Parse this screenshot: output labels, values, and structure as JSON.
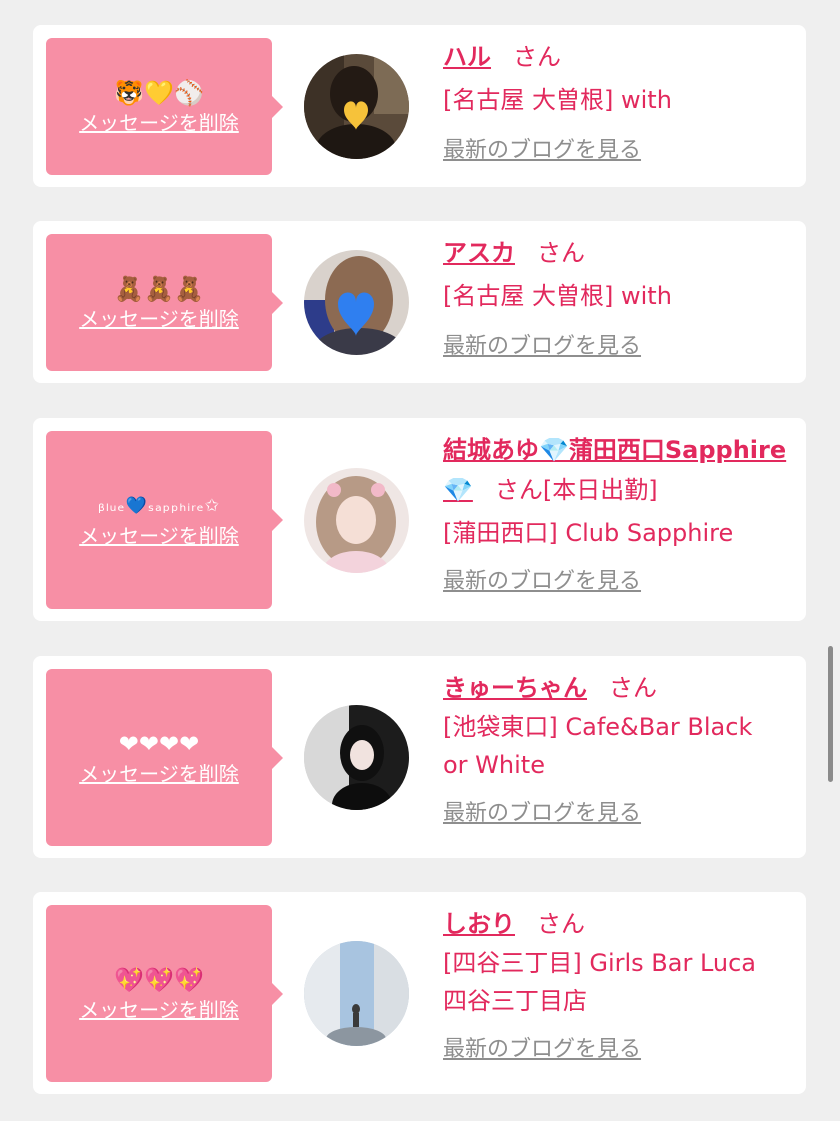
{
  "cards": [
    {
      "message": "🐯💛⚾",
      "delete_label": "メッセージを削除",
      "name": "ハル",
      "honorific": "さん",
      "extra": "",
      "shop_lines": [
        "[名古屋 大曽根] with"
      ],
      "blog_link": "最新のブログを見る",
      "avatar_icon": "heart-emoji"
    },
    {
      "message": "🧸🧸🧸",
      "delete_label": "メッセージを削除",
      "name": "アスカ",
      "honorific": "さん",
      "extra": "",
      "shop_lines": [
        "[名古屋 大曽根] with"
      ],
      "blog_link": "最新のブログを見る",
      "avatar_icon": "blue-heart-emoji"
    },
    {
      "message": "ᵦₗᵤₑ💙ₛₐₚₚₕᵢᵣₑ✩",
      "delete_label": "メッセージを削除",
      "name": "結城あゆ💎蒲田西口Sapphire💎",
      "honorific": "さん",
      "extra": "[本日出勤]",
      "shop_lines": [
        "[蒲田西口] Club Sapphire"
      ],
      "blog_link": "最新のブログを見る",
      "avatar_icon": "portrait"
    },
    {
      "message": "❤❤❤❤",
      "delete_label": "メッセージを削除",
      "name": "きゅーちゃん",
      "honorific": "さん",
      "extra": "",
      "shop_lines": [
        "[池袋東口] Cafe&Bar Black",
        "or White"
      ],
      "blog_link": "最新のブログを見る",
      "avatar_icon": "portrait"
    },
    {
      "message": "💖💖💖",
      "delete_label": "メッセージを削除",
      "name": "しおり",
      "honorific": "さん",
      "extra": "",
      "shop_lines": [
        "[四谷三丁目] Girls Bar Luca",
        "四谷三丁目店"
      ],
      "blog_link": "最新のブログを見る",
      "avatar_icon": "photo"
    }
  ],
  "colors": {
    "accent": "#e2295d",
    "bubble": "#f78fa5",
    "background": "#efefef",
    "link_gray": "#8e8e8e"
  }
}
